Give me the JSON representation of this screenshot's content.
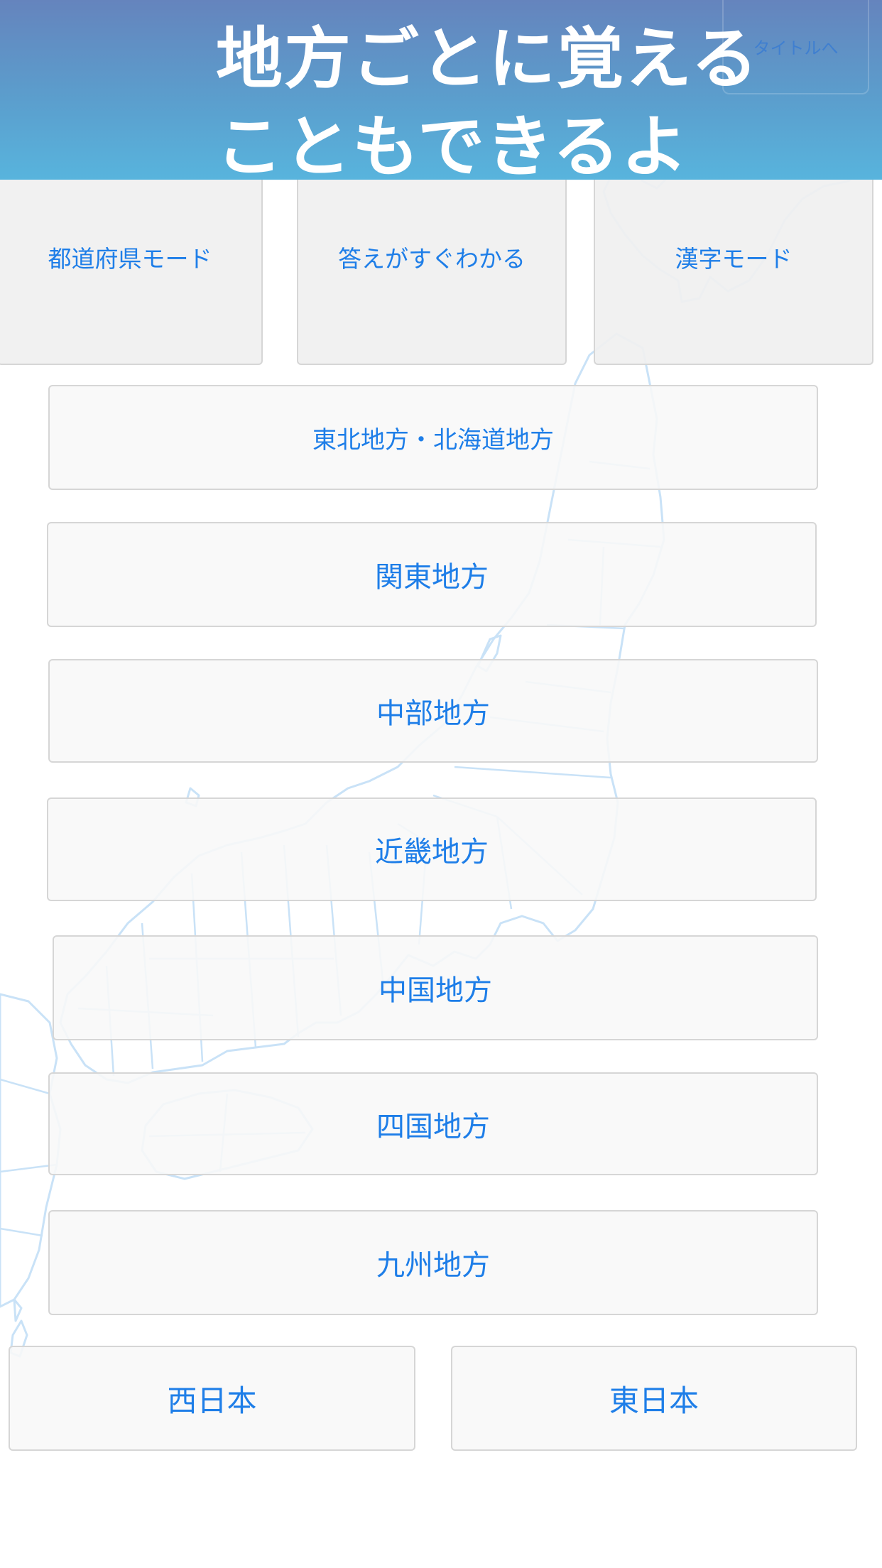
{
  "banner": {
    "line1": "地方ごとに覚える",
    "line2": "こともできるよ"
  },
  "nav": {
    "title_label": "タイトルへ"
  },
  "modes": [
    {
      "label": "都道府県モード"
    },
    {
      "label": "答えがすぐわかる"
    },
    {
      "label": "漢字モード"
    }
  ],
  "regions": [
    {
      "label": "東北地方・北海道地方"
    },
    {
      "label": "関東地方"
    },
    {
      "label": "中部地方"
    },
    {
      "label": "近畿地方"
    },
    {
      "label": "中国地方"
    },
    {
      "label": "四国地方"
    },
    {
      "label": "九州地方"
    }
  ],
  "halves": [
    {
      "label": "西日本"
    },
    {
      "label": "東日本"
    }
  ],
  "colors": {
    "accent": "#1e7ee8",
    "banner_top": "#6584bd",
    "banner_bottom": "#58b4dd",
    "map_outline": "#c9e2f7",
    "button_border": "#d6d6d6"
  },
  "icons": {
    "background": "japan-map-outline-icon"
  }
}
